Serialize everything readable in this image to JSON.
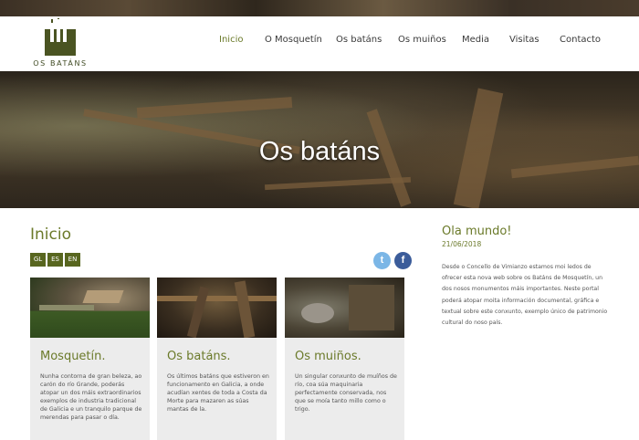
{
  "site": {
    "logo_text": "OS BATÁNS"
  },
  "nav": {
    "items": [
      {
        "label": "Inicio",
        "active": true
      },
      {
        "label": "O Mosquetín",
        "active": false
      },
      {
        "label": "Os batáns",
        "active": false
      },
      {
        "label": "Os muiños",
        "active": false
      },
      {
        "label": "Media",
        "active": false
      },
      {
        "label": "Visitas",
        "active": false
      },
      {
        "label": "Contacto",
        "active": false
      }
    ]
  },
  "hero": {
    "title": "Os batáns"
  },
  "main": {
    "page_title": "Inicio",
    "languages": [
      "GL",
      "ES",
      "EN"
    ],
    "social": [
      {
        "name": "twitter-icon",
        "glyph": "t",
        "color": "#7bb6e6"
      },
      {
        "name": "facebook-icon",
        "glyph": "f",
        "color": "#3b5c9a"
      }
    ],
    "cards": [
      {
        "title": "Mosquetín.",
        "text": "Nunha contorna de gran beleza, ao carón do río Grande, poderás atopar un dos máis extraordinarios exemplos de industria tradicional de Galicia e un tranquilo parque de merendas para pasar o día."
      },
      {
        "title": "Os batáns.",
        "text": "Os últimos batáns que estiveron en funcionamento en Galicia, a onde acudían xentes de toda a Costa da Morte para mazaren as súas mantas de la."
      },
      {
        "title": "Os muiños.",
        "text": "Un singular conxunto de muíños de río, coa súa maquinaria perfectamente conservada, nos que se moía tanto millo como o trigo."
      }
    ]
  },
  "sidebar": {
    "post_title": "Ola mundo!",
    "post_date": "21/06/2018",
    "post_text": "Desde o Concello de Vimianzo estamos moi ledos de ofrecer esta nova web sobre os Batáns de Mosquetín, un dos nosos monumentos máis importantes. Neste portal poderá atopar moita información documental, gráfica e textual sobre este conxunto, exemplo único de patrimonio cultural do noso país."
  },
  "colors": {
    "accent": "#6b7a2a",
    "lang_button": "#58661f",
    "card_bg": "#ececec"
  }
}
